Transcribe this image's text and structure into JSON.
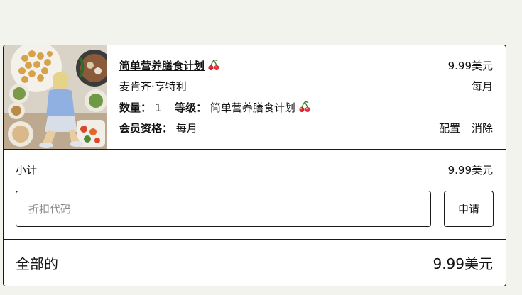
{
  "cart": {
    "item": {
      "image_alt": "healthy meal prep plan photo",
      "title": "简单营养膳食计划",
      "seller": "麦肯齐·亨特利",
      "price": "9.99美元",
      "period": "每月",
      "quantity_label": "数量：",
      "quantity": "1",
      "tier_label": "等级：",
      "tier": "简单营养膳食计划",
      "membership_label": "会员资格：",
      "membership": "每月",
      "configure_label": "配置",
      "remove_label": "消除",
      "icon": "cherry-icon"
    },
    "subtotal_label": "小计",
    "subtotal_value": "9.99美元",
    "discount_placeholder": "折扣代码",
    "discount_value": "",
    "apply_label": "申请",
    "total_label": "全部的",
    "total_value": "9.99美元"
  }
}
